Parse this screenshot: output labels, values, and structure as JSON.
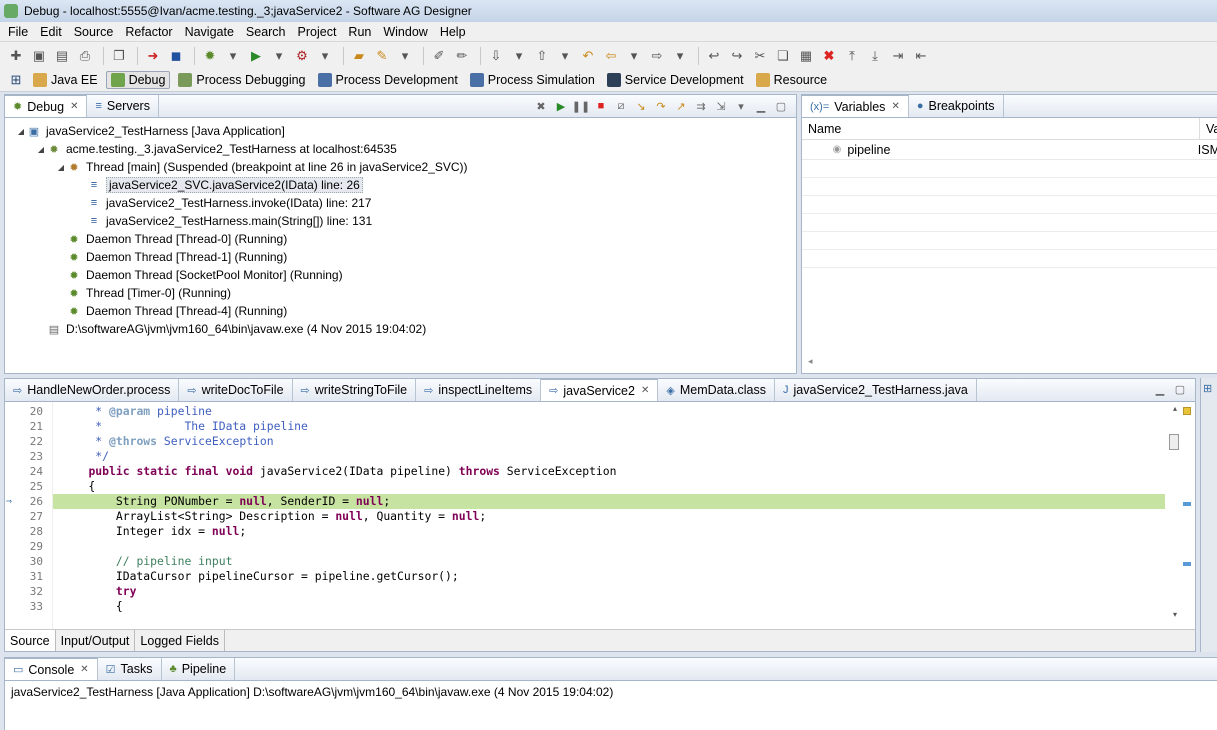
{
  "window": {
    "title": "Debug - localhost:5555@Ivan/acme.testing._3;javaService2 - Software AG Designer"
  },
  "menu": [
    "File",
    "Edit",
    "Source",
    "Refactor",
    "Navigate",
    "Search",
    "Project",
    "Run",
    "Window",
    "Help"
  ],
  "perspectives": [
    {
      "label": "Java EE",
      "color": "#d9a84a",
      "active": false
    },
    {
      "label": "Debug",
      "color": "#6fa34c",
      "active": true
    },
    {
      "label": "Process Debugging",
      "color": "#7a9a5a",
      "active": false
    },
    {
      "label": "Process Development",
      "color": "#4a6fa5",
      "active": false
    },
    {
      "label": "Process Simulation",
      "color": "#4a6fa5",
      "active": false
    },
    {
      "label": "Service Development",
      "color": "#2d3e57",
      "active": false
    },
    {
      "label": "Resource",
      "color": "#d9a84a",
      "active": false
    }
  ],
  "debug_view": {
    "tabs": [
      {
        "label": "Debug"
      },
      {
        "label": "Servers"
      }
    ],
    "tree": [
      {
        "indent": 0,
        "twisty": "◢",
        "icon": "app-icon",
        "label": "javaService2_TestHarness [Java Application]"
      },
      {
        "indent": 1,
        "twisty": "◢",
        "icon": "process-icon",
        "label": "acme.testing._3.javaService2_TestHarness at localhost:64535"
      },
      {
        "indent": 2,
        "twisty": "◢",
        "icon": "thread-suspended-icon",
        "label": "Thread [main] (Suspended (breakpoint at line 26 in javaService2_SVC))"
      },
      {
        "indent": 3,
        "twisty": "",
        "icon": "stack-frame-icon",
        "label": "javaService2_SVC.javaService2(IData) line: 26",
        "selected": true
      },
      {
        "indent": 3,
        "twisty": "",
        "icon": "stack-frame-icon",
        "label": "javaService2_TestHarness.invoke(IData) line: 217"
      },
      {
        "indent": 3,
        "twisty": "",
        "icon": "stack-frame-icon",
        "label": "javaService2_TestHarness.main(String[]) line: 131"
      },
      {
        "indent": 2,
        "twisty": "",
        "icon": "thread-running-icon",
        "label": "Daemon Thread [Thread-0] (Running)"
      },
      {
        "indent": 2,
        "twisty": "",
        "icon": "thread-running-icon",
        "label": "Daemon Thread [Thread-1] (Running)"
      },
      {
        "indent": 2,
        "twisty": "",
        "icon": "thread-running-icon",
        "label": "Daemon Thread [SocketPool Monitor] (Running)"
      },
      {
        "indent": 2,
        "twisty": "",
        "icon": "thread-running-icon",
        "label": "Thread [Timer-0] (Running)"
      },
      {
        "indent": 2,
        "twisty": "",
        "icon": "thread-running-icon",
        "label": "Daemon Thread [Thread-4] (Running)"
      },
      {
        "indent": 1,
        "twisty": "",
        "icon": "jvm-process-icon",
        "label": "D:\\softwareAG\\jvm\\jvm160_64\\bin\\javaw.exe (4 Nov 2015 19:04:02)"
      }
    ]
  },
  "variables_view": {
    "tabs": [
      {
        "label": "Variables"
      },
      {
        "label": "Breakpoints"
      }
    ],
    "columns": [
      "Name",
      "Va"
    ],
    "rows": [
      {
        "name": "pipeline",
        "value": "ISM"
      }
    ]
  },
  "editor": {
    "tabs": [
      {
        "label": "HandleNewOrder.process",
        "active": false
      },
      {
        "label": "writeDocToFile",
        "active": false
      },
      {
        "label": "writeStringToFile",
        "active": false
      },
      {
        "label": "inspectLineItems",
        "active": false
      },
      {
        "label": "javaService2",
        "active": true
      },
      {
        "label": "MemData.class",
        "active": false
      },
      {
        "label": "javaService2_TestHarness.java",
        "active": false
      }
    ],
    "lines": [
      {
        "n": "20",
        "html": "     <span class=\"cm\">* <span class=\"tag\">@param</span> pipeline</span>"
      },
      {
        "n": "21",
        "html": "     <span class=\"cm\">*            The IData pipeline</span>"
      },
      {
        "n": "22",
        "html": "     <span class=\"cm\">* <span class=\"tag\">@throws</span> ServiceException</span>"
      },
      {
        "n": "23",
        "html": "     <span class=\"cm\">*/</span>"
      },
      {
        "n": "24",
        "html": "    <span class=\"kw\">public static final void</span> javaService2(IData pipeline) <span class=\"kw\">throws</span> ServiceException"
      },
      {
        "n": "25",
        "html": "    {"
      },
      {
        "n": "26",
        "html": "        String PONumber = <span class=\"kw\">null</span>, SenderID = <span class=\"kw\">null</span>;",
        "highlight": true
      },
      {
        "n": "27",
        "html": "        ArrayList&lt;String&gt; Description = <span class=\"kw\">null</span>, Quantity = <span class=\"kw\">null</span>;"
      },
      {
        "n": "28",
        "html": "        Integer idx = <span class=\"kw\">null</span>;"
      },
      {
        "n": "29",
        "html": ""
      },
      {
        "n": "30",
        "html": "        <span class=\"cmt\">// pipeline input</span>"
      },
      {
        "n": "31",
        "html": "        IDataCursor pipelineCursor = pipeline.getCursor();"
      },
      {
        "n": "32",
        "html": "        <span class=\"kw\">try</span>"
      },
      {
        "n": "33",
        "html": "        {"
      }
    ],
    "sub_tabs": [
      {
        "label": "Source",
        "active": true
      },
      {
        "label": "Input/Output",
        "active": false
      },
      {
        "label": "Logged Fields",
        "active": false
      }
    ]
  },
  "console_view": {
    "tabs": [
      {
        "label": "Console"
      },
      {
        "label": "Tasks"
      },
      {
        "label": "Pipeline"
      }
    ],
    "text": "javaService2_TestHarness [Java Application] D:\\softwareAG\\jvm\\jvm160_64\\bin\\javaw.exe (4 Nov 2015 19:04:02)"
  }
}
